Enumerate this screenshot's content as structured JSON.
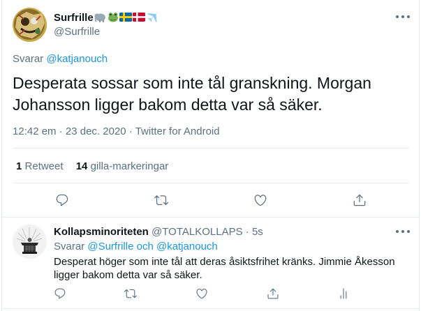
{
  "tweet": {
    "author_name": "Surfrille",
    "author_handle": "@Surfrille",
    "replying_prefix": "Svarar",
    "replying_to": "@katjanouch",
    "text_line1": "Desperata sossar som inte tål granskning. Morgan",
    "text_line2": "Johansson ligger bakom detta var så säker.",
    "time": "12:42 em",
    "date": "23 dec. 2020",
    "source": "Twitter for Android",
    "separator": "·",
    "retweet_count": "1",
    "retweet_label": "Retweet",
    "like_count": "14",
    "like_label": "gilla-markeringar"
  },
  "reply": {
    "author_name": "Kollapsminoriteten",
    "author_handle": "@TOTALKOLLAPS",
    "separator": "·",
    "age": "5s",
    "replying_prefix": "Svarar",
    "replying_to_1": "@Surfrille",
    "replying_conj": "och",
    "replying_to_2": "@katjanouch",
    "text_line1": "Desperat höger som inte tål att deras åsiktsfrihet kränks. Jimmie Åkesson",
    "text_line2": "ligger bakom detta var så säker."
  },
  "icons": {
    "reply": "reply-icon",
    "retweet": "retweet-icon",
    "like": "heart-icon",
    "share": "share-icon",
    "analytics": "analytics-icon"
  },
  "colors": {
    "text": "#0f1419",
    "muted": "#5b7083",
    "link": "#1b95e0",
    "divider": "#e6ecf0"
  }
}
